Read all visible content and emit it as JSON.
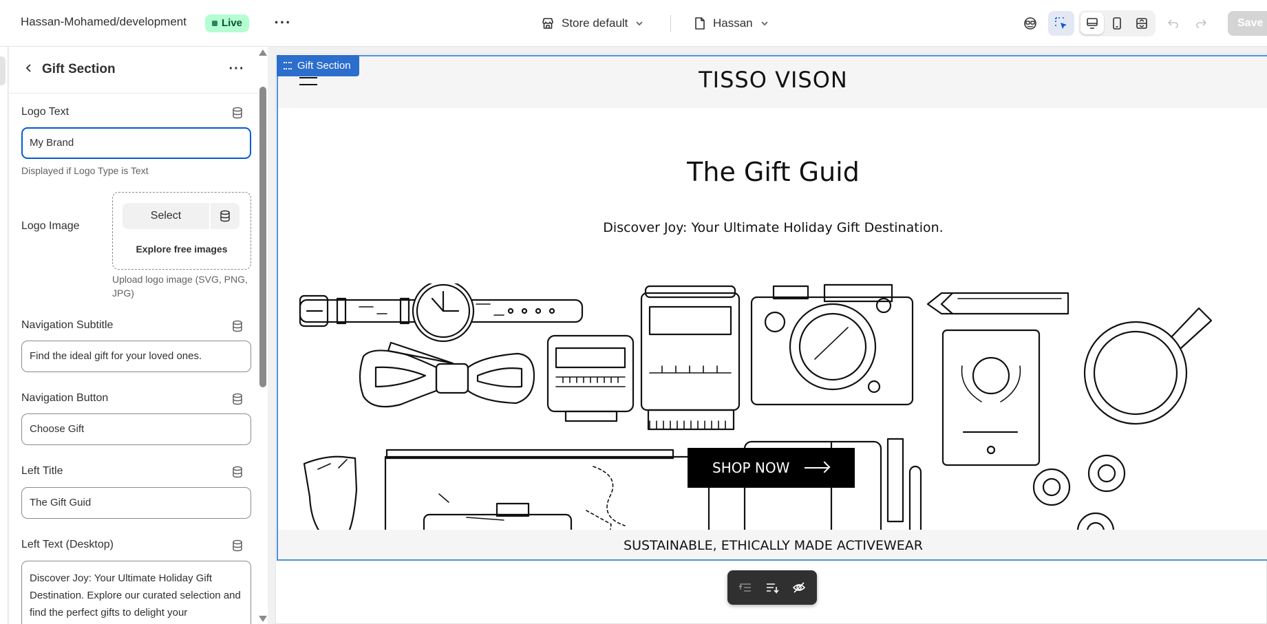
{
  "topbar": {
    "store_name": "Hassan-Mohamed/development",
    "live_label": "Live",
    "theme_context": "Store default",
    "page_context": "Hassan",
    "save_label": "Save"
  },
  "sidebar": {
    "title": "Gift Section",
    "logo_text": {
      "label": "Logo Text",
      "value": "My Brand",
      "help": "Displayed if Logo Type is Text"
    },
    "logo_image": {
      "label": "Logo Image",
      "select_label": "Select",
      "explore_label": "Explore free images",
      "help": "Upload logo image (SVG, PNG, JPG)"
    },
    "nav_subtitle": {
      "label": "Navigation Subtitle",
      "value": "Find the ideal gift for your loved ones."
    },
    "nav_button": {
      "label": "Navigation Button",
      "value": "Choose Gift"
    },
    "left_title": {
      "label": "Left Title",
      "value": "The Gift Guid"
    },
    "left_text_desktop": {
      "label": "Left Text (Desktop)",
      "value": "Discover Joy: Your Ultimate Holiday Gift Destination. Explore our curated selection and find the perfect gifts to delight your"
    }
  },
  "preview": {
    "section_tag": "Gift Section",
    "logo": "TISSO VISON",
    "hero_title": "The Gift Guid",
    "hero_subtitle": "Discover Joy: Your Ultimate Holiday Gift Destination.",
    "cta_label": "SHOP NOW",
    "bottom_text": "SUSTAINABLE, ETHICALLY MADE ACTIVEWEAR"
  },
  "colors": {
    "accent": "#005bd3",
    "section_outline": "#4a90e2",
    "live_badge_bg": "#b4fed2",
    "live_badge_text": "#0c5132"
  },
  "icons": [
    "store-icon",
    "page-icon",
    "chevron-down-icon",
    "inspector-icon",
    "select-element-icon",
    "desktop-icon",
    "mobile-icon",
    "fullscreen-icon",
    "undo-icon",
    "redo-icon",
    "back-arrow-icon",
    "more-icon",
    "database-icon",
    "hamburger-icon",
    "arrow-right-icon",
    "move-up-icon",
    "reorder-icon",
    "hide-icon"
  ]
}
